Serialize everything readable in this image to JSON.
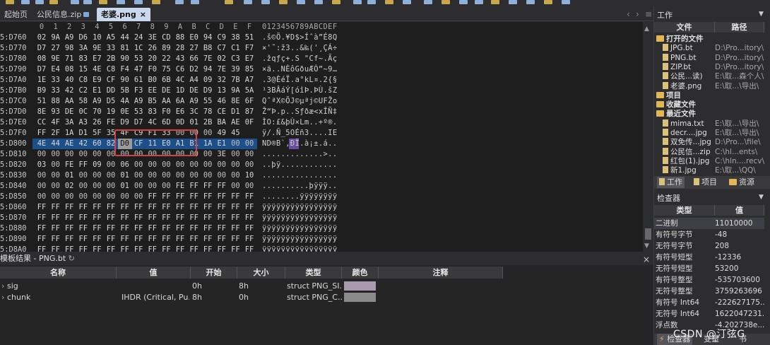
{
  "tabs": [
    {
      "label": "起始页",
      "active": false
    },
    {
      "label": "公民信息.zip",
      "active": false,
      "locked": true
    },
    {
      "label": "老婆.png",
      "active": true,
      "close": "×"
    }
  ],
  "hex": {
    "column_headers": [
      "0",
      "1",
      "2",
      "3",
      "4",
      "5",
      "6",
      "7",
      "8",
      "9",
      "A",
      "B",
      "C",
      "D",
      "E",
      "F"
    ],
    "ascii_header": "0123456789ABCDEF",
    "rows": [
      {
        "addr": "5:D760",
        "bytes": [
          "02",
          "9A",
          "A9",
          "D6",
          "10",
          "A5",
          "44",
          "24",
          "3E",
          "CD",
          "88",
          "E0",
          "94",
          "C9",
          "38",
          "51"
        ],
        "ascii": ".š©Ö.¥D$>Íˆà”É8Q"
      },
      {
        "addr": "5:D770",
        "bytes": [
          "D7",
          "27",
          "98",
          "3A",
          "9E",
          "33",
          "81",
          "1C",
          "26",
          "89",
          "28",
          "27",
          "B8",
          "C7",
          "C1",
          "F7"
        ],
        "ascii": "×'˜:ž3..&‰('¸ÇÁ÷"
      },
      {
        "addr": "5:D780",
        "bytes": [
          "08",
          "9E",
          "71",
          "83",
          "E7",
          "2B",
          "90",
          "53",
          "20",
          "22",
          "43",
          "66",
          "7E",
          "02",
          "C3",
          "E7"
        ],
        "ascii": ".žqƒç+.S \"Cf~.Ãç"
      },
      {
        "addr": "5:D790",
        "bytes": [
          "D7",
          "E4",
          "08",
          "15",
          "4E",
          "C8",
          "F4",
          "47",
          "F0",
          "75",
          "C6",
          "D2",
          "94",
          "7E",
          "39",
          "85"
        ],
        "ascii": "×ä..NÈôGðuÆÒ”~9…"
      },
      {
        "addr": "5:D7A0",
        "bytes": [
          "1E",
          "33",
          "40",
          "C8",
          "E9",
          "CF",
          "90",
          "61",
          "B0",
          "6B",
          "4C",
          "A4",
          "09",
          "32",
          "7B",
          "A7"
        ],
        "ascii": ".3@ÈéÏ.a°kL¤.2{§"
      },
      {
        "addr": "5:D7B0",
        "bytes": [
          "B9",
          "33",
          "42",
          "C2",
          "E1",
          "DD",
          "5B",
          "F3",
          "EE",
          "DE",
          "1D",
          "DE",
          "D9",
          "13",
          "9A",
          "5A"
        ],
        "ascii": "¹3BÂáÝ[óîÞ.ÞÙ.šZ"
      },
      {
        "addr": "5:D7C0",
        "bytes": [
          "51",
          "88",
          "AA",
          "58",
          "A9",
          "D5",
          "4A",
          "A9",
          "B5",
          "AA",
          "6A",
          "A9",
          "55",
          "46",
          "8E",
          "6F"
        ],
        "ascii": "QˆªX©ÕJ©µªj©UFŽo"
      },
      {
        "addr": "5:D7D0",
        "bytes": [
          "8E",
          "93",
          "DE",
          "0C",
          "70",
          "19",
          "0E",
          "53",
          "83",
          "F0",
          "E6",
          "3C",
          "78",
          "CE",
          "D1",
          "87"
        ],
        "ascii": "Ž“Þ.p..Sƒðæ<xÎÑ‡"
      },
      {
        "addr": "5:D7E0",
        "bytes": [
          "CC",
          "4F",
          "3A",
          "A3",
          "26",
          "FE",
          "D9",
          "D7",
          "4C",
          "6D",
          "0D",
          "01",
          "2B",
          "BA",
          "AE",
          "0F"
        ],
        "ascii": "ÌO:£&þÙ×Lm..+º®."
      },
      {
        "addr": "5:D7F0",
        "bytes": [
          "FF",
          "2F",
          "1A",
          "D1",
          "5F",
          "35",
          "4F",
          "C9",
          "F1",
          "33",
          "00",
          "00",
          "00",
          "49",
          "45"
        ],
        "ascii": "ÿ/.Ñ_5OÉñ3....IE"
      },
      {
        "addr": "5:D800",
        "bytes": [
          "4E",
          "44",
          "AE",
          "42",
          "60",
          "82",
          "D0",
          "CF",
          "11",
          "E0",
          "A1",
          "B1",
          "1A",
          "E1",
          "00",
          "00"
        ],
        "ascii": "ND®B`‚ÐÏ.à¡±.á.."
      },
      {
        "addr": "5:D810",
        "bytes": [
          "00",
          "00",
          "00",
          "00",
          "00",
          "00",
          "00",
          "00",
          "00",
          "00",
          "00",
          "00",
          "00",
          "3E",
          "00",
          "00"
        ],
        "ascii": ".............>.."
      },
      {
        "addr": "5:D820",
        "bytes": [
          "03",
          "00",
          "FE",
          "FF",
          "09",
          "00",
          "06",
          "00",
          "00",
          "00",
          "00",
          "00",
          "00",
          "00",
          "00",
          "00"
        ],
        "ascii": "..þÿ............"
      },
      {
        "addr": "5:D830",
        "bytes": [
          "00",
          "00",
          "01",
          "00",
          "00",
          "00",
          "01",
          "00",
          "00",
          "00",
          "00",
          "00",
          "00",
          "00",
          "00",
          "10"
        ],
        "ascii": "................"
      },
      {
        "addr": "5:D840",
        "bytes": [
          "00",
          "00",
          "02",
          "00",
          "00",
          "00",
          "01",
          "00",
          "00",
          "00",
          "FE",
          "FF",
          "FF",
          "FF",
          "00",
          "00"
        ],
        "ascii": "..........þÿÿÿ.."
      },
      {
        "addr": "5:D850",
        "bytes": [
          "00",
          "00",
          "00",
          "00",
          "00",
          "00",
          "00",
          "00",
          "FF",
          "FF",
          "FF",
          "FF",
          "FF",
          "FF",
          "FF",
          "FF"
        ],
        "ascii": "........ÿÿÿÿÿÿÿÿ"
      },
      {
        "addr": "5:D860",
        "bytes": [
          "FF",
          "FF",
          "FF",
          "FF",
          "FF",
          "FF",
          "FF",
          "FF",
          "FF",
          "FF",
          "FF",
          "FF",
          "FF",
          "FF",
          "FF",
          "FF"
        ],
        "ascii": "ÿÿÿÿÿÿÿÿÿÿÿÿÿÿÿÿ"
      },
      {
        "addr": "5:D870",
        "bytes": [
          "FF",
          "FF",
          "FF",
          "FF",
          "FF",
          "FF",
          "FF",
          "FF",
          "FF",
          "FF",
          "FF",
          "FF",
          "FF",
          "FF",
          "FF",
          "FF"
        ],
        "ascii": "ÿÿÿÿÿÿÿÿÿÿÿÿÿÿÿÿ"
      },
      {
        "addr": "5:D880",
        "bytes": [
          "FF",
          "FF",
          "FF",
          "FF",
          "FF",
          "FF",
          "FF",
          "FF",
          "FF",
          "FF",
          "FF",
          "FF",
          "FF",
          "FF",
          "FF",
          "FF"
        ],
        "ascii": "ÿÿÿÿÿÿÿÿÿÿÿÿÿÿÿÿ"
      },
      {
        "addr": "5:D890",
        "bytes": [
          "FF",
          "FF",
          "FF",
          "FF",
          "FF",
          "FF",
          "FF",
          "FF",
          "FF",
          "FF",
          "FF",
          "FF",
          "FF",
          "FF",
          "FF",
          "FF"
        ],
        "ascii": "ÿÿÿÿÿÿÿÿÿÿÿÿÿÿÿÿ"
      },
      {
        "addr": "5:D8A0",
        "bytes": [
          "FF",
          "FF",
          "FF",
          "FF",
          "FF",
          "FF",
          "FF",
          "FF",
          "FF",
          "FF",
          "FF",
          "FF",
          "FF",
          "FF",
          "FF",
          "FF"
        ],
        "ascii": "ÿÿÿÿÿÿÿÿÿÿÿÿÿÿÿÿ"
      },
      {
        "addr": "5:D8B0",
        "bytes": [
          "FF",
          "FF",
          "FF",
          "FF",
          "FF",
          "FF",
          "FF",
          "FF",
          "FF",
          "FF",
          "FF",
          "FF",
          "FF",
          "FF",
          "FF",
          "FF"
        ],
        "ascii": "ÿÿÿÿÿÿÿÿÿÿÿÿÿÿÿÿ"
      }
    ]
  },
  "template_results": {
    "title": "模板结果 - PNG.bt",
    "columns": [
      "名称",
      "值",
      "开始",
      "大小",
      "类型",
      "颜色",
      "注释"
    ],
    "rows": [
      {
        "name": "sig",
        "value": "",
        "start": "0h",
        "size": "8h",
        "type": "struct PNG_SI...",
        "color": "#a89aaf"
      },
      {
        "name": "chunk",
        "value": "IHDR  (Critical, Pu...",
        "start": "8h",
        "size": "0h",
        "type": "struct PNG_C...",
        "color": "#8a8a8a"
      }
    ]
  },
  "workspace": {
    "title": "工作",
    "columns": [
      "文件",
      "路径"
    ],
    "groups": [
      {
        "label": "打开的文件",
        "items": [
          {
            "name": "JPG.bt",
            "path": "D:\\Pro...itory\\"
          },
          {
            "name": "PNG.bt",
            "path": "D:\\Pro...itory\\"
          },
          {
            "name": "ZIP.bt",
            "path": "D:\\Pro...itory\\"
          },
          {
            "name": "公民...读)",
            "path": "E:\\取...森个人\\"
          },
          {
            "name": "老婆.png",
            "path": "E:\\取...\\导出\\"
          }
        ]
      },
      {
        "label": "项目",
        "items": []
      },
      {
        "label": "收藏文件",
        "items": []
      },
      {
        "label": "最近文件",
        "items": [
          {
            "name": "mima.txt",
            "path": "E:\\取...\\导出\\"
          },
          {
            "name": "decr....jpg",
            "path": "E:\\取...\\导出\\"
          },
          {
            "name": "双免传...jpg",
            "path": "D:\\Pro...\\file\\"
          },
          {
            "name": "公民信...zip",
            "path": "C:\\hl...ents\\"
          },
          {
            "name": "红包(1).jpg",
            "path": "C:\\hln....recv\\"
          },
          {
            "name": "新1.jpg",
            "path": "E:\\取...\\QQ\\"
          }
        ]
      }
    ],
    "bottom_tabs": [
      "工作",
      "项目",
      "资源"
    ]
  },
  "inspector": {
    "title": "检查器",
    "columns": [
      "类型",
      "值"
    ],
    "rows": [
      {
        "k": "二进制",
        "v": "11010000"
      },
      {
        "k": "有符号字节",
        "v": "-48"
      },
      {
        "k": "无符号字节",
        "v": "208"
      },
      {
        "k": "有符号短型",
        "v": "-12336"
      },
      {
        "k": "无符号短型",
        "v": "53200"
      },
      {
        "k": "有符号整型",
        "v": "-535703600"
      },
      {
        "k": "无符号整型",
        "v": "3759263696"
      },
      {
        "k": "有符号 Int64",
        "v": "-222627175..."
      },
      {
        "k": "无符号 Int64",
        "v": "1622047231..."
      },
      {
        "k": "浮点数",
        "v": "-4.202738e..."
      }
    ],
    "bottom_tabs": [
      "检查器",
      "变量",
      "书"
    ]
  },
  "watermark": "CSDN @汀弦G"
}
